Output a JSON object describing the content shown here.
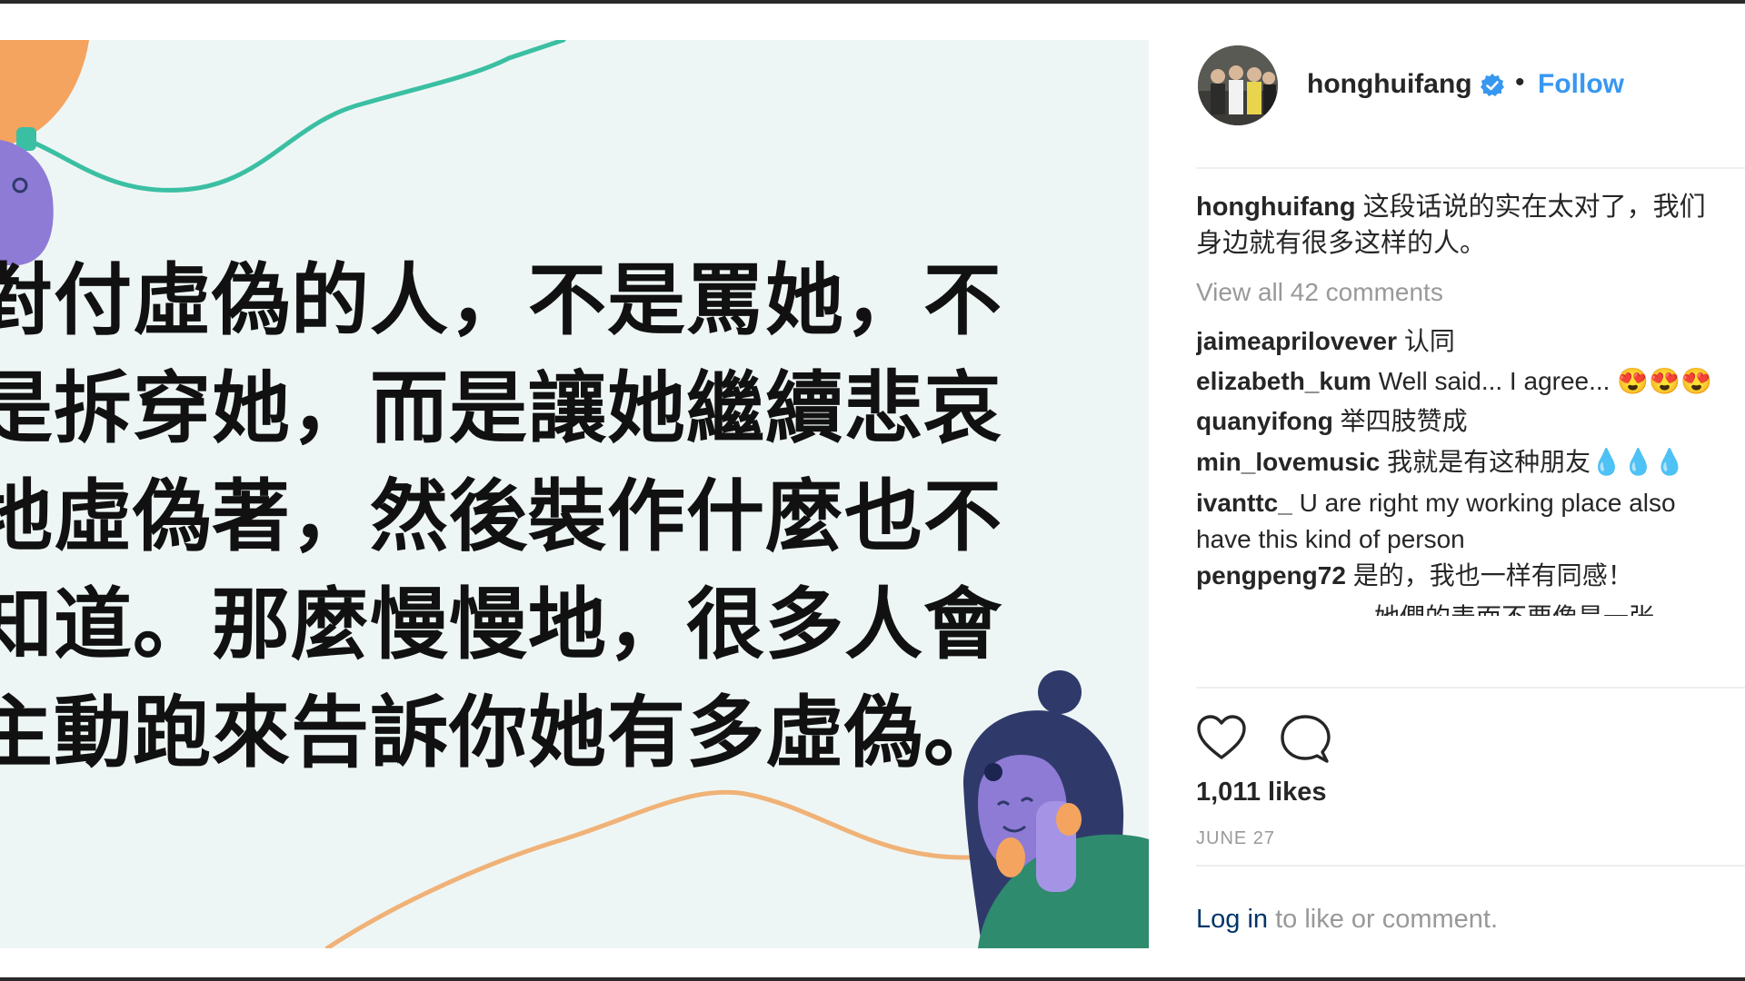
{
  "post": {
    "quote_lines": [
      "對付虛偽的人，不是罵她，不",
      "是拆穿她，而是讓她繼續悲哀",
      "地虛偽著，然後裝作什麼也不",
      "知道。那麼慢慢地，很多人會",
      "主動跑來告訴你她有多虛偽。"
    ],
    "colors": {
      "background": "#eef6f5",
      "teal_line": "#3bbfa3",
      "orange": "#f4a45f",
      "purple": "#8e7bd6",
      "navy": "#2f3a6b",
      "green": "#2e8b6e"
    }
  },
  "panel": {
    "username": "honghuifang",
    "verified_icon": "verified-badge-icon",
    "separator": "•",
    "follow_label": "Follow",
    "caption": {
      "user": "honghuifang",
      "text_line1": "这段话说的实在太对了，我们",
      "text_line2": "身边就有很多这样的人。"
    },
    "view_all": "View all 42 comments",
    "comments": [
      {
        "user": "jaimeaprilovever",
        "text": "认同"
      },
      {
        "user": "elizabeth_kum",
        "text": "Well said... I agree... 😍😍😍"
      },
      {
        "user": "quanyifong",
        "text": "举四肢赞成"
      },
      {
        "user": "min_lovemusic",
        "text": "我就是有这种朋友💧💧💧"
      },
      {
        "user": "ivanttc_",
        "text": "U are right my working place also",
        "text2": "have this kind of person"
      },
      {
        "user": "pengpeng72",
        "text": "是的，我也一样有同感！"
      },
      {
        "user": "",
        "text": "她們的表面不要像是一张"
      }
    ],
    "likes": "1,011 likes",
    "date": "JUNE 27",
    "login_link": "Log in",
    "login_rest": " to like or comment.",
    "accent": "#3897f0"
  }
}
